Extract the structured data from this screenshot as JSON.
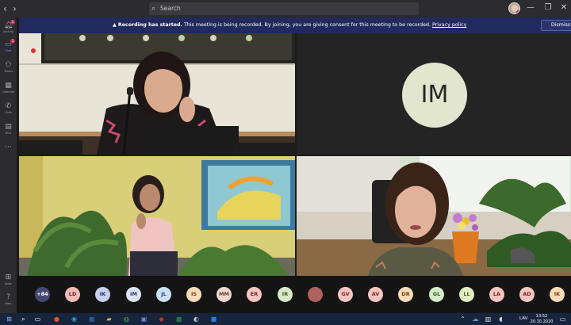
{
  "titlebar": {
    "back_icon": "back-arrow-icon",
    "forward_icon": "forward-arrow-icon",
    "search_placeholder": "Search",
    "window_controls": [
      "—",
      "❐",
      "✕"
    ]
  },
  "rail": {
    "items": [
      {
        "label": "Activity",
        "icon": "bell-icon",
        "badge": "1"
      },
      {
        "label": "Chat",
        "icon": "chat-icon",
        "badge": "1",
        "active": true
      },
      {
        "label": "Teams",
        "icon": "teams-icon"
      },
      {
        "label": "Calendar",
        "icon": "calendar-icon"
      },
      {
        "label": "Calls",
        "icon": "phone-icon"
      },
      {
        "label": "Files",
        "icon": "files-icon"
      },
      {
        "label": "",
        "icon": "more-icon"
      }
    ],
    "bottom": [
      {
        "label": "Apps",
        "icon": "apps-icon"
      },
      {
        "label": "Help",
        "icon": "help-icon"
      }
    ]
  },
  "banner": {
    "bold": "Recording has started.",
    "text": " This meeting is being recorded. By joining, you are giving consent for this meeting to be recorded. ",
    "link": "Privacy policy",
    "dismiss": "Dismiss",
    "bg": "#212a5e"
  },
  "tiles": {
    "im_initials": "IM"
  },
  "participants": [
    {
      "initials": "+84",
      "color": "#464775",
      "text": "#ffffff"
    },
    {
      "initials": "LD",
      "color": "#f2b8b5",
      "text": "#5a2a2a"
    },
    {
      "initials": "IK",
      "color": "#c7cdeb",
      "text": "#2f3566"
    },
    {
      "initials": "IM",
      "color": "#dde4f6",
      "text": "#2f3566"
    },
    {
      "initials": "JL",
      "color": "#cbe0f5",
      "text": "#1f4a7a"
    },
    {
      "initials": "IS",
      "color": "#f8dbb8",
      "text": "#6b4215"
    },
    {
      "initials": "MM",
      "color": "#f3d7cf",
      "text": "#6b3a2a"
    },
    {
      "initials": "ER",
      "color": "#f7c5c0",
      "text": "#6b2a2a"
    },
    {
      "initials": "IR",
      "color": "#d9e8c7",
      "text": "#3a5a1f"
    },
    {
      "initials": "",
      "color": "#b0605f",
      "text": "#ffffff",
      "photo": true
    },
    {
      "initials": "GV",
      "color": "#f7c5c0",
      "text": "#6b2a2a"
    },
    {
      "initials": "AV",
      "color": "#f7c5c0",
      "text": "#6b2a2a"
    },
    {
      "initials": "DR",
      "color": "#f8dbb8",
      "text": "#6b4215"
    },
    {
      "initials": "GL",
      "color": "#d4ecc7",
      "text": "#2f5a1f"
    },
    {
      "initials": "LL",
      "color": "#e3efc2",
      "text": "#4a5a1f"
    },
    {
      "initials": "LA",
      "color": "#f7c5c0",
      "text": "#6b2a2a"
    },
    {
      "initials": "AD",
      "color": "#f7c5c0",
      "text": "#6b2a2a"
    },
    {
      "initials": "IK",
      "color": "#f8dbb8",
      "text": "#6b4215"
    }
  ],
  "taskbar": {
    "lang": "LAV",
    "time": "13:52",
    "date": "20.10.2020"
  }
}
